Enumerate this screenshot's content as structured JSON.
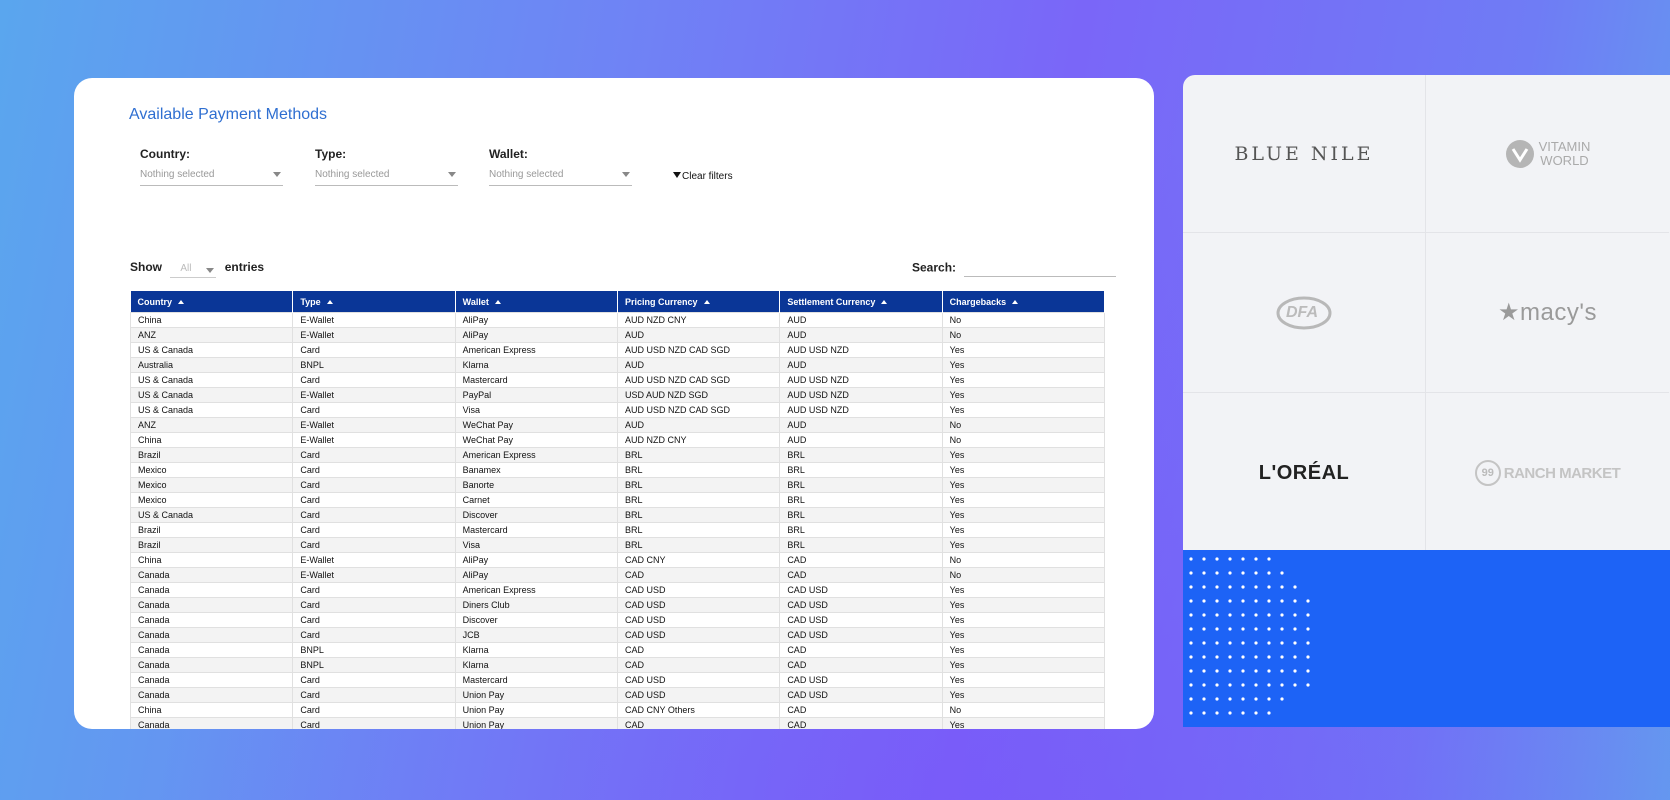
{
  "page": {
    "title": "Available Payment Methods",
    "filters": [
      {
        "label": "Country:",
        "value": "Nothing selected"
      },
      {
        "label": "Type:",
        "value": "Nothing selected"
      },
      {
        "label": "Wallet:",
        "value": "Nothing selected"
      }
    ],
    "clear_filters": "Clear filters",
    "show_label": "Show",
    "entries_value": "All",
    "entries_label": "entries",
    "search_label": "Search:",
    "search_value": ""
  },
  "table": {
    "headers": [
      "Country",
      "Type",
      "Wallet",
      "Pricing Currency",
      "Settlement Currency",
      "Chargebacks"
    ],
    "rows": [
      [
        "China",
        "E-Wallet",
        "AliPay",
        "AUD NZD CNY",
        "AUD",
        "No"
      ],
      [
        "ANZ",
        "E-Wallet",
        "AliPay",
        "AUD",
        "AUD",
        "No"
      ],
      [
        "US & Canada",
        "Card",
        "American Express",
        "AUD USD NZD CAD SGD",
        "AUD USD NZD",
        "Yes"
      ],
      [
        "Australia",
        "BNPL",
        "Klarna",
        "AUD",
        "AUD",
        "Yes"
      ],
      [
        "US & Canada",
        "Card",
        "Mastercard",
        "AUD USD NZD CAD SGD",
        "AUD USD NZD",
        "Yes"
      ],
      [
        "US & Canada",
        "E-Wallet",
        "PayPal",
        "USD AUD NZD SGD",
        "AUD USD NZD",
        "Yes"
      ],
      [
        "US & Canada",
        "Card",
        "Visa",
        "AUD USD NZD CAD SGD",
        "AUD USD NZD",
        "Yes"
      ],
      [
        "ANZ",
        "E-Wallet",
        "WeChat Pay",
        "AUD",
        "AUD",
        "No"
      ],
      [
        "China",
        "E-Wallet",
        "WeChat Pay",
        "AUD NZD CNY",
        "AUD",
        "No"
      ],
      [
        "Brazil",
        "Card",
        "American Express",
        "BRL",
        "BRL",
        "Yes"
      ],
      [
        "Mexico",
        "Card",
        "Banamex",
        "BRL",
        "BRL",
        "Yes"
      ],
      [
        "Mexico",
        "Card",
        "Banorte",
        "BRL",
        "BRL",
        "Yes"
      ],
      [
        "Mexico",
        "Card",
        "Carnet",
        "BRL",
        "BRL",
        "Yes"
      ],
      [
        "US & Canada",
        "Card",
        "Discover",
        "BRL",
        "BRL",
        "Yes"
      ],
      [
        "Brazil",
        "Card",
        "Mastercard",
        "BRL",
        "BRL",
        "Yes"
      ],
      [
        "Brazil",
        "Card",
        "Visa",
        "BRL",
        "BRL",
        "Yes"
      ],
      [
        "China",
        "E-Wallet",
        "AliPay",
        "CAD CNY",
        "CAD",
        "No"
      ],
      [
        "Canada",
        "E-Wallet",
        "AliPay",
        "CAD",
        "CAD",
        "No"
      ],
      [
        "Canada",
        "Card",
        "American Express",
        "CAD USD",
        "CAD USD",
        "Yes"
      ],
      [
        "Canada",
        "Card",
        "Diners Club",
        "CAD USD",
        "CAD USD",
        "Yes"
      ],
      [
        "Canada",
        "Card",
        "Discover",
        "CAD USD",
        "CAD USD",
        "Yes"
      ],
      [
        "Canada",
        "Card",
        "JCB",
        "CAD USD",
        "CAD USD",
        "Yes"
      ],
      [
        "Canada",
        "BNPL",
        "Klarna",
        "CAD",
        "CAD",
        "Yes"
      ],
      [
        "Canada",
        "BNPL",
        "Klarna",
        "CAD",
        "CAD",
        "Yes"
      ],
      [
        "Canada",
        "Card",
        "Mastercard",
        "CAD USD",
        "CAD USD",
        "Yes"
      ],
      [
        "Canada",
        "Card",
        "Union Pay",
        "CAD USD",
        "CAD USD",
        "Yes"
      ],
      [
        "China",
        "Card",
        "Union Pay",
        "CAD CNY Others",
        "CAD",
        "No"
      ],
      [
        "Canada",
        "Card",
        "Union Pay",
        "CAD",
        "CAD",
        "Yes"
      ]
    ]
  },
  "logos": {
    "blue_nile": "BLUE NILE",
    "vitamin_world_1": "VITAMIN",
    "vitamin_world_2": "WORLD",
    "dfa": "DFA",
    "macys": "★macy's",
    "loreal": "L'ORÉAL",
    "ranch_99": "99",
    "ranch_text": "RANCH MARKET"
  },
  "colors": {
    "header_bg": "#0a3697",
    "title": "#2f6fd1",
    "blue_panel": "#1d63f6"
  }
}
